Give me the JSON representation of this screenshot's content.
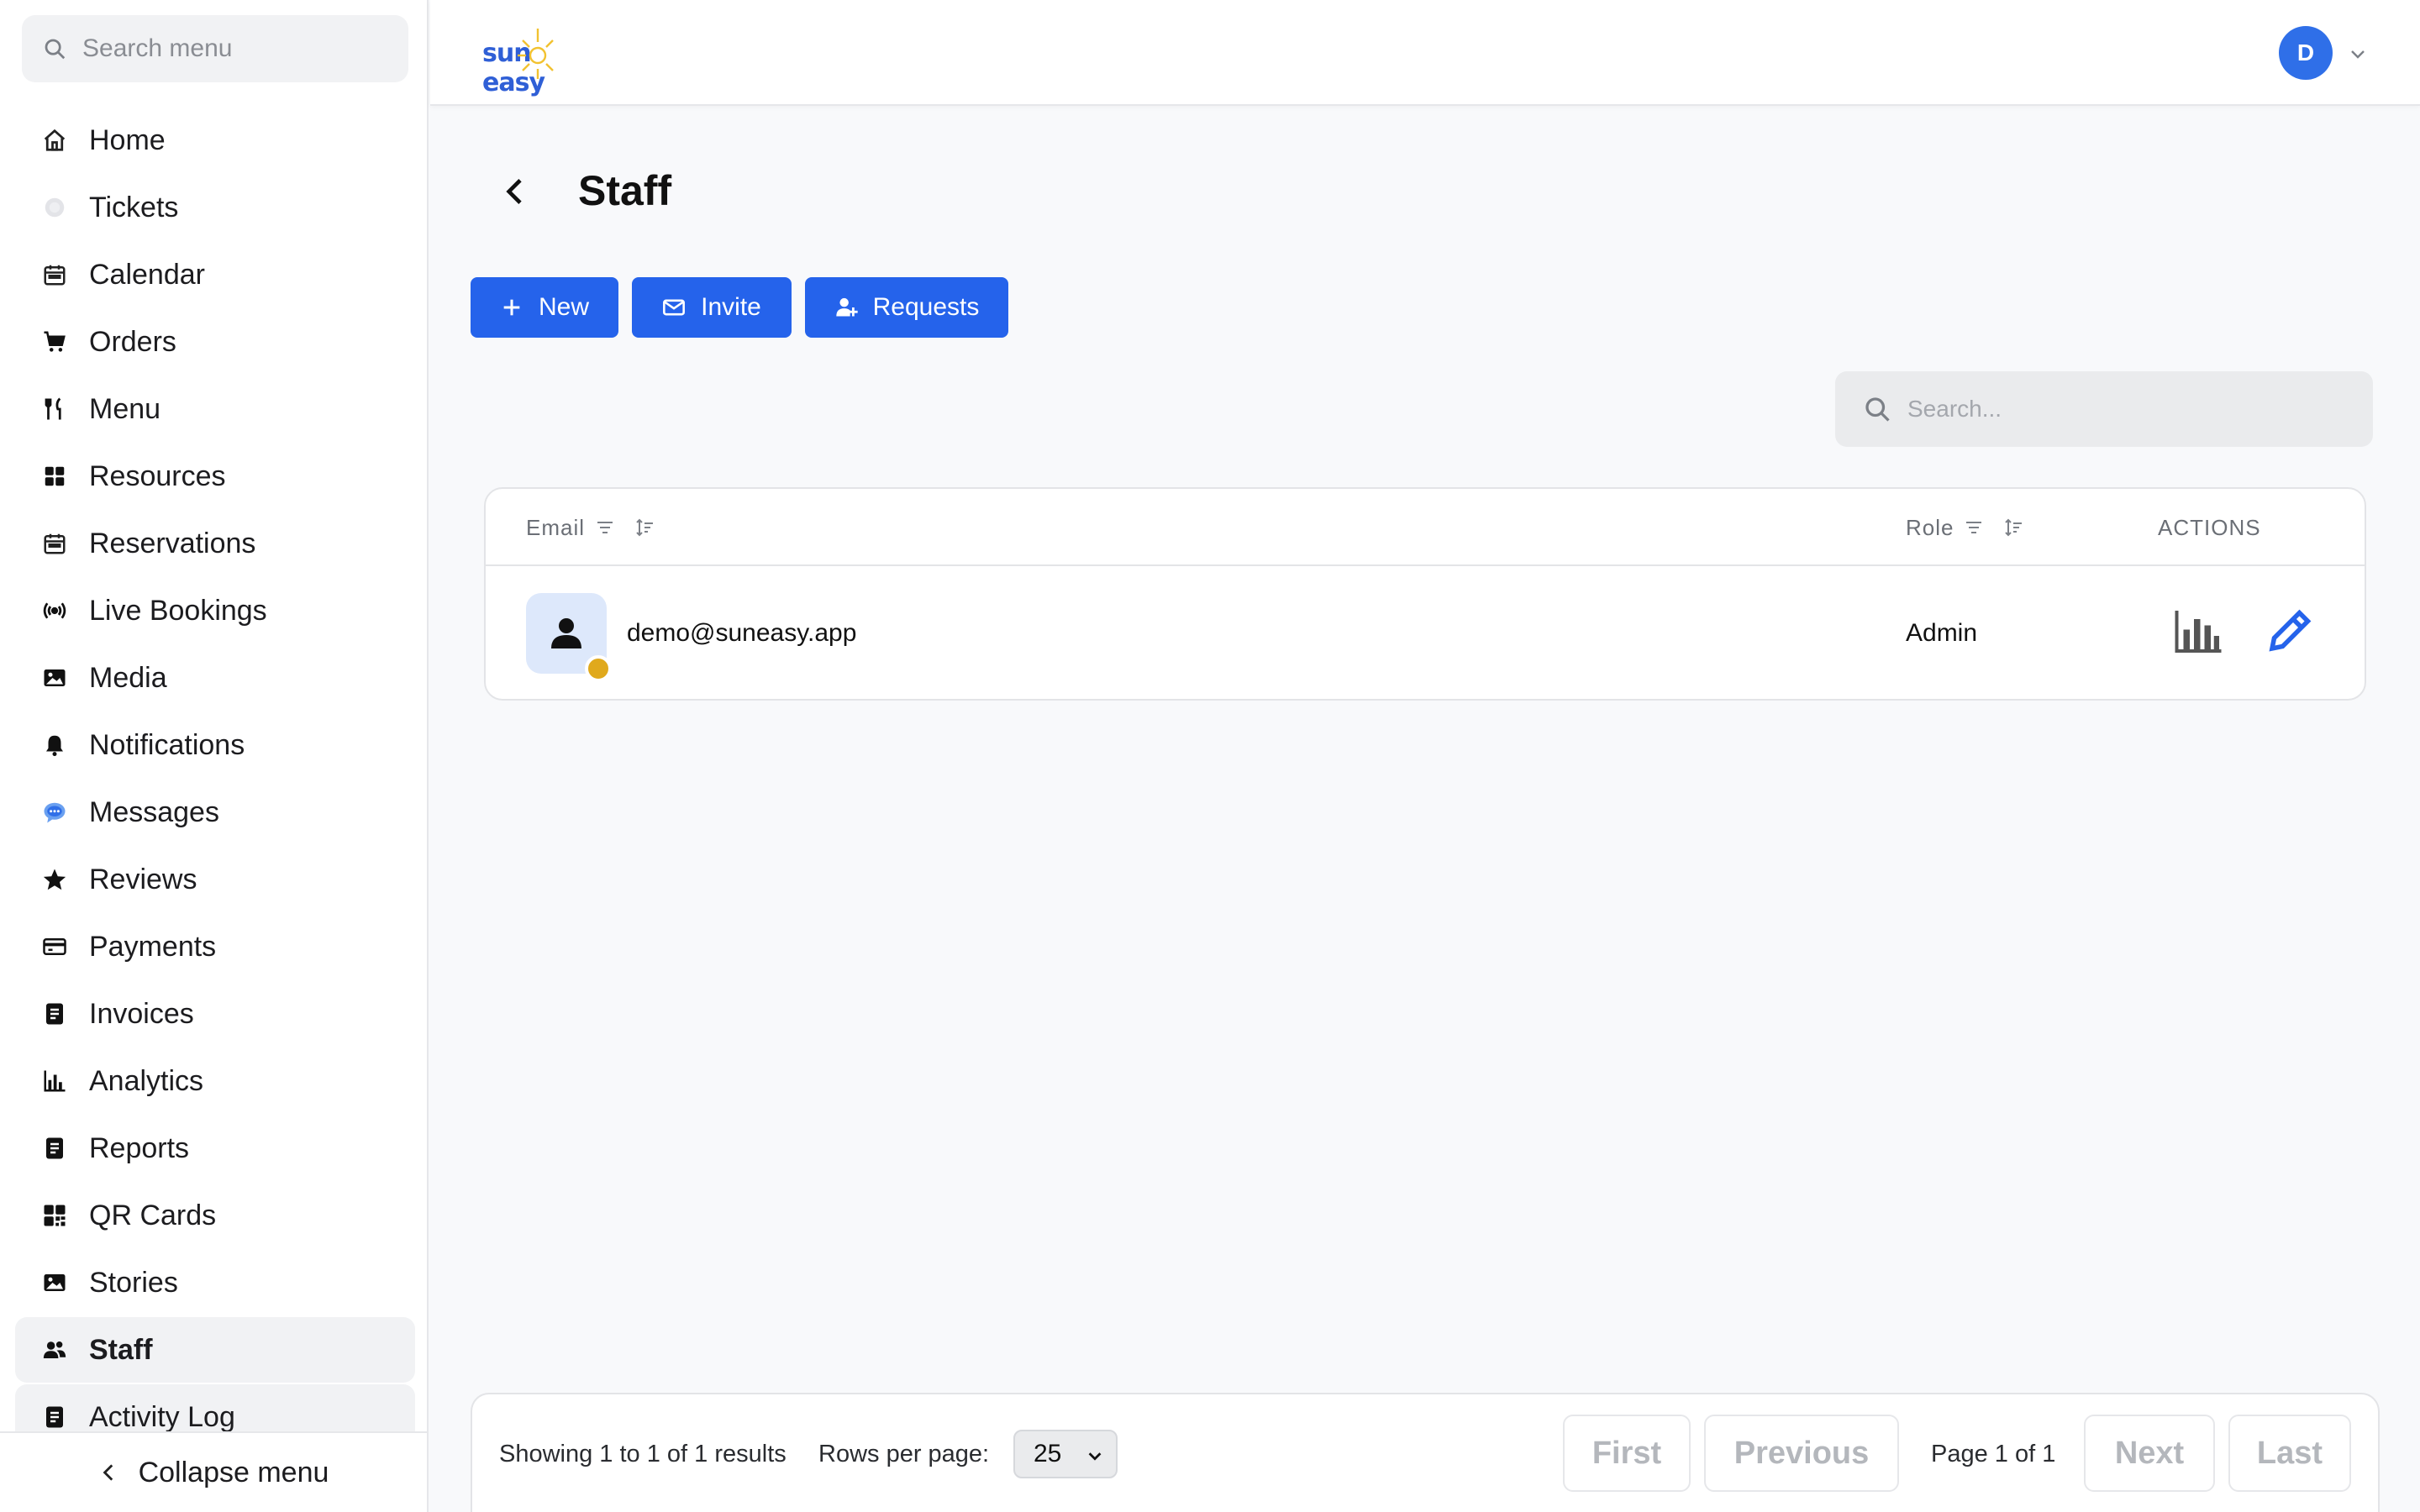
{
  "sidebar": {
    "search_placeholder": "Search menu",
    "items": [
      {
        "label": "Home",
        "icon": "home-icon"
      },
      {
        "label": "Tickets",
        "icon": "ticket-icon"
      },
      {
        "label": "Calendar",
        "icon": "calendar-icon"
      },
      {
        "label": "Orders",
        "icon": "cart-icon"
      },
      {
        "label": "Menu",
        "icon": "utensils-icon"
      },
      {
        "label": "Resources",
        "icon": "grid-icon"
      },
      {
        "label": "Reservations",
        "icon": "calendar-icon"
      },
      {
        "label": "Live Bookings",
        "icon": "broadcast-icon"
      },
      {
        "label": "Media",
        "icon": "image-icon"
      },
      {
        "label": "Notifications",
        "icon": "bell-icon"
      },
      {
        "label": "Messages",
        "icon": "chat-icon"
      },
      {
        "label": "Reviews",
        "icon": "star-icon"
      },
      {
        "label": "Payments",
        "icon": "credit-card-icon"
      },
      {
        "label": "Invoices",
        "icon": "document-icon"
      },
      {
        "label": "Analytics",
        "icon": "bar-chart-icon"
      },
      {
        "label": "Reports",
        "icon": "document-icon"
      },
      {
        "label": "QR Cards",
        "icon": "qr-icon"
      },
      {
        "label": "Stories",
        "icon": "image-icon"
      },
      {
        "label": "Staff",
        "icon": "users-icon"
      },
      {
        "label": "Activity Log",
        "icon": "document-icon"
      }
    ],
    "active": "Staff",
    "collapse_label": "Collapse menu"
  },
  "header": {
    "logo_text_left": "sun",
    "logo_text_right": "easy",
    "avatar_initial": "D"
  },
  "main": {
    "title": "Staff",
    "buttons": {
      "new": "New",
      "invite": "Invite",
      "requests": "Requests"
    },
    "search_placeholder": "Search...",
    "table": {
      "columns": {
        "email": "Email",
        "role": "Role",
        "actions": "ACTIONS"
      },
      "rows": [
        {
          "email": "demo@suneasy.app",
          "role": "Admin"
        }
      ]
    },
    "pagination": {
      "showing": "Showing 1 to 1 of 1 results",
      "rows_per_page_label": "Rows per page:",
      "rows_per_page_value": "25",
      "first": "First",
      "previous": "Previous",
      "page_info": "Page 1 of 1",
      "next": "Next",
      "last": "Last"
    }
  },
  "colors": {
    "accent": "#2563eb",
    "status_dot": "#e0a91c",
    "avatar_bg": "#2f6fe8"
  }
}
